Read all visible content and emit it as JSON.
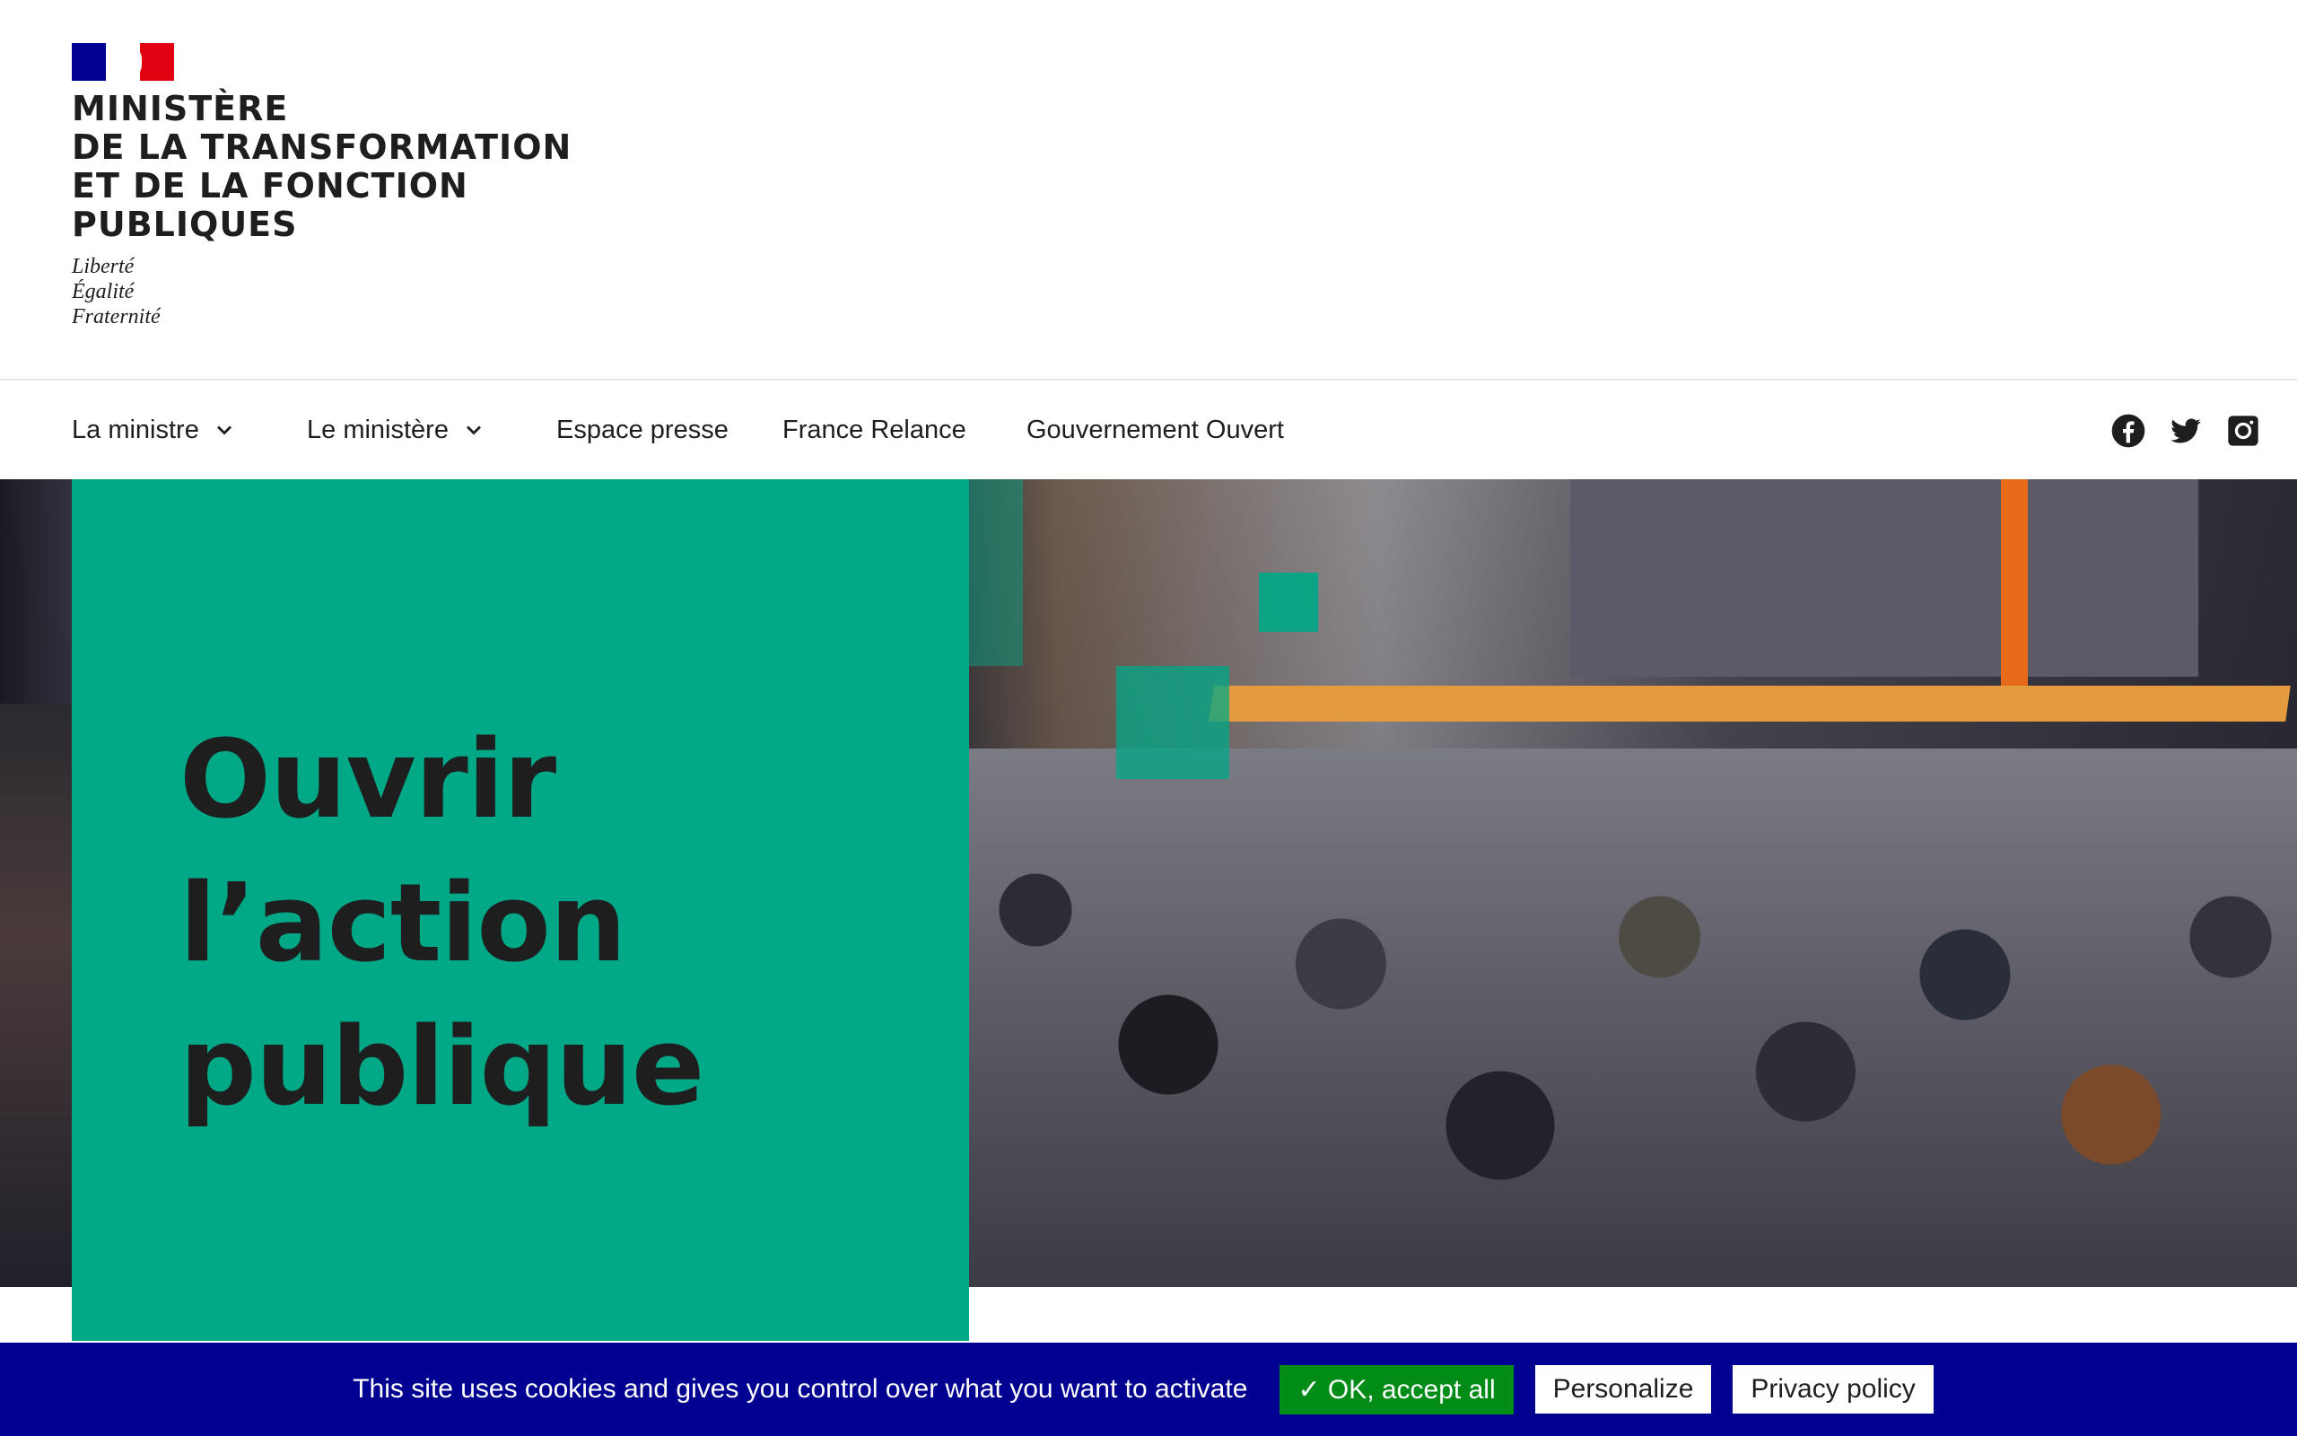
{
  "header": {
    "logo_lines": [
      "MINISTÈRE",
      "DE LA TRANSFORMATION",
      "ET DE LA FONCTION",
      "PUBLIQUES"
    ],
    "motto": [
      "Liberté",
      "Égalité",
      "Fraternité"
    ],
    "flag_colors": {
      "blue": "#000091",
      "white": "#ffffff",
      "red": "#e1000f"
    }
  },
  "nav": {
    "items": [
      {
        "label": "La ministre",
        "has_dropdown": true
      },
      {
        "label": "Le ministère",
        "has_dropdown": true
      },
      {
        "label": "Espace presse",
        "has_dropdown": false
      },
      {
        "label": "France Relance",
        "has_dropdown": false
      },
      {
        "label": "Gouvernement Ouvert",
        "has_dropdown": false
      }
    ],
    "social": [
      "facebook-icon",
      "twitter-icon",
      "instagram-icon"
    ]
  },
  "hero": {
    "title_lines": [
      "Ouvrir",
      "l’action",
      "publique"
    ],
    "panel_color": "#00a887"
  },
  "cookie_banner": {
    "text": "This site uses cookies and gives you control over what you want to activate",
    "accept_label": "✓ OK, accept all",
    "personalize_label": "Personalize",
    "privacy_label": "Privacy policy",
    "background": "#000091",
    "accept_color": "#008c16"
  }
}
